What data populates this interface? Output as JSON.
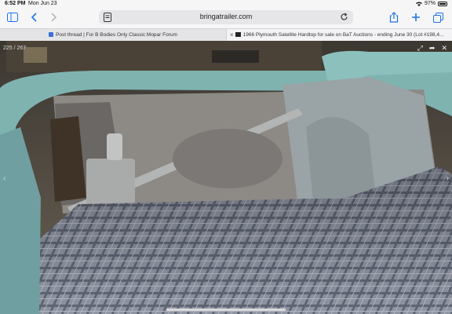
{
  "status": {
    "time": "6:52 PM",
    "date": "Mon Jun 23",
    "battery": "97%"
  },
  "toolbar": {
    "url": "bringatrailer.com",
    "icons": [
      "sidebar-icon",
      "back-icon",
      "forward-icon",
      "reader-icon",
      "reload-icon",
      "share-icon",
      "new-tab-icon",
      "tab-overview-icon"
    ]
  },
  "tabs": [
    {
      "title": "Post thread | For B Bodies Only Classic Mopar Forum",
      "active": false
    },
    {
      "title": "1966 Plymouth Satellite Hardtop for sale on BaT Auctions - ending June 30 (Lot #198,4...",
      "active": true
    }
  ],
  "gallery": {
    "counter": "225 / 267"
  },
  "colors": {
    "accent": "#1a73e8",
    "car_paint": "#7fb3b0",
    "trunk_mat": "#8d93a0"
  }
}
